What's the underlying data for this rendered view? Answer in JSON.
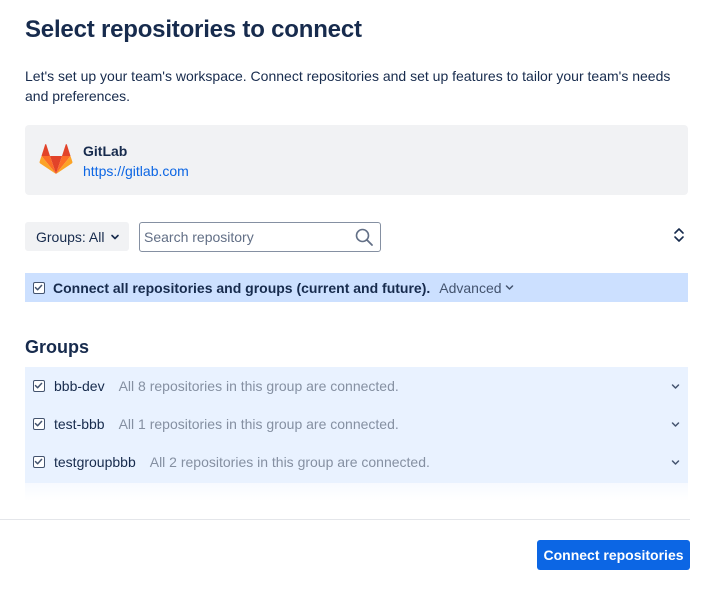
{
  "page": {
    "title": "Select repositories to connect",
    "description": "Let's set up your team's workspace. Connect repositories and set up features to tailor your team's needs and preferences."
  },
  "provider": {
    "name": "GitLab",
    "url": "https://gitlab.com",
    "icon": "gitlab-logo-icon"
  },
  "filters": {
    "groups_label": "Groups: All",
    "search_placeholder": "Search repository",
    "search_value": ""
  },
  "connect_all": {
    "checked": true,
    "label": "Connect all repositories and groups (current and future).",
    "advanced_label": "Advanced"
  },
  "groups": {
    "heading": "Groups",
    "items": [
      {
        "name": "bbb-dev",
        "status": "All 8 repositories in this group are connected.",
        "checked": true
      },
      {
        "name": "test-bbb",
        "status": "All 1 repositories in this group are connected.",
        "checked": true
      },
      {
        "name": "testgroupbbb",
        "status": "All 2 repositories in this group are connected.",
        "checked": true
      }
    ]
  },
  "footer": {
    "connect_button_label": "Connect repositories"
  },
  "colors": {
    "accent": "#0c66e4",
    "selected_row": "#cce0ff",
    "group_list_bg": "#e9f2ff",
    "card_bg": "#f1f2f4"
  }
}
